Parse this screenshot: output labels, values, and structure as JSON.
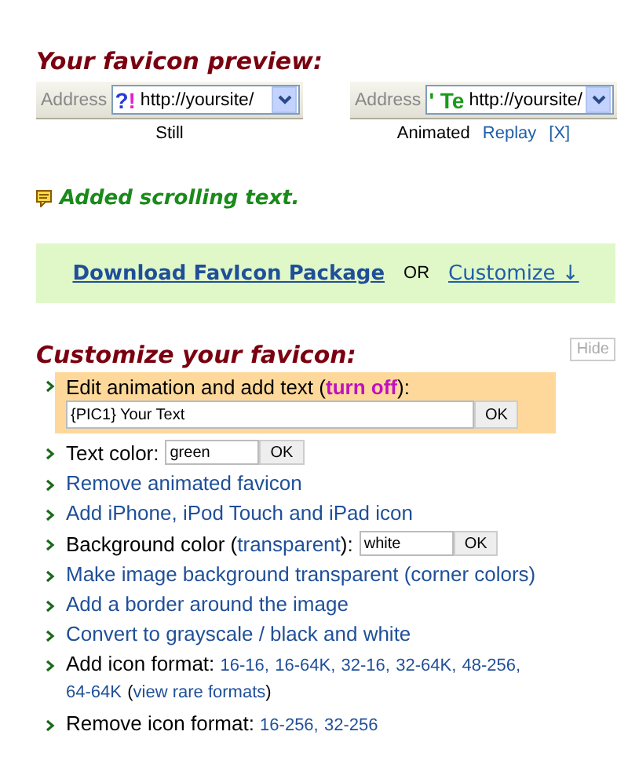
{
  "preview": {
    "title": "Your favicon preview:",
    "bars": [
      {
        "address_label": "Address",
        "favicon": [
          {
            "text": "?",
            "color": "#2a3ad0"
          },
          {
            "text": "!",
            "color": "#e020d0"
          }
        ],
        "url": "http://yoursite/",
        "caption": "Still"
      },
      {
        "address_label": "Address",
        "favicon": [
          {
            "text": "' Te",
            "color": "#1a9a1a"
          }
        ],
        "url": "http://yoursite/",
        "caption": "Animated",
        "links": [
          "Replay",
          "[X]"
        ]
      }
    ]
  },
  "notice": "Added scrolling text.",
  "download": {
    "link": "Download FavIcon Package",
    "or": "OR",
    "customize": "Customize ↓"
  },
  "customize": {
    "title": "Customize your favicon:",
    "hide_button": "Hide",
    "items": [
      {
        "kind": "field",
        "highlighted": true,
        "prefix": "Edit animation and add text (",
        "link": "turn off",
        "suffix": "):",
        "value": "{PIC1} Your Text",
        "button": "OK"
      },
      {
        "kind": "field",
        "highlighted": false,
        "prefix": "Text color:",
        "value": "green",
        "button": "OK"
      },
      {
        "kind": "link",
        "link": "Remove animated favicon"
      },
      {
        "kind": "link",
        "link": "Add iPhone, iPod Touch and iPad icon"
      },
      {
        "kind": "field",
        "highlighted": false,
        "prefix": "Background color (",
        "link": "transparent",
        "suffix": "):",
        "value": "white",
        "button": "OK"
      },
      {
        "kind": "link",
        "link": "Make image background transparent (corner colors)"
      },
      {
        "kind": "link",
        "link": "Add a border around the image"
      },
      {
        "kind": "link",
        "link": "Convert to grayscale / black and white"
      },
      {
        "kind": "formats",
        "prefix": "Add icon format:",
        "links": [
          "16-16",
          "16-64K",
          "32-16",
          "32-64K",
          "48-256",
          "64-64K"
        ],
        "separator": ",",
        "extra": {
          "open": "(",
          "link": "view rare formats",
          "close": ")"
        }
      },
      {
        "kind": "formats",
        "prefix": "Remove icon format:",
        "links": [
          "16-256",
          "32-256"
        ],
        "separator": ","
      }
    ]
  }
}
